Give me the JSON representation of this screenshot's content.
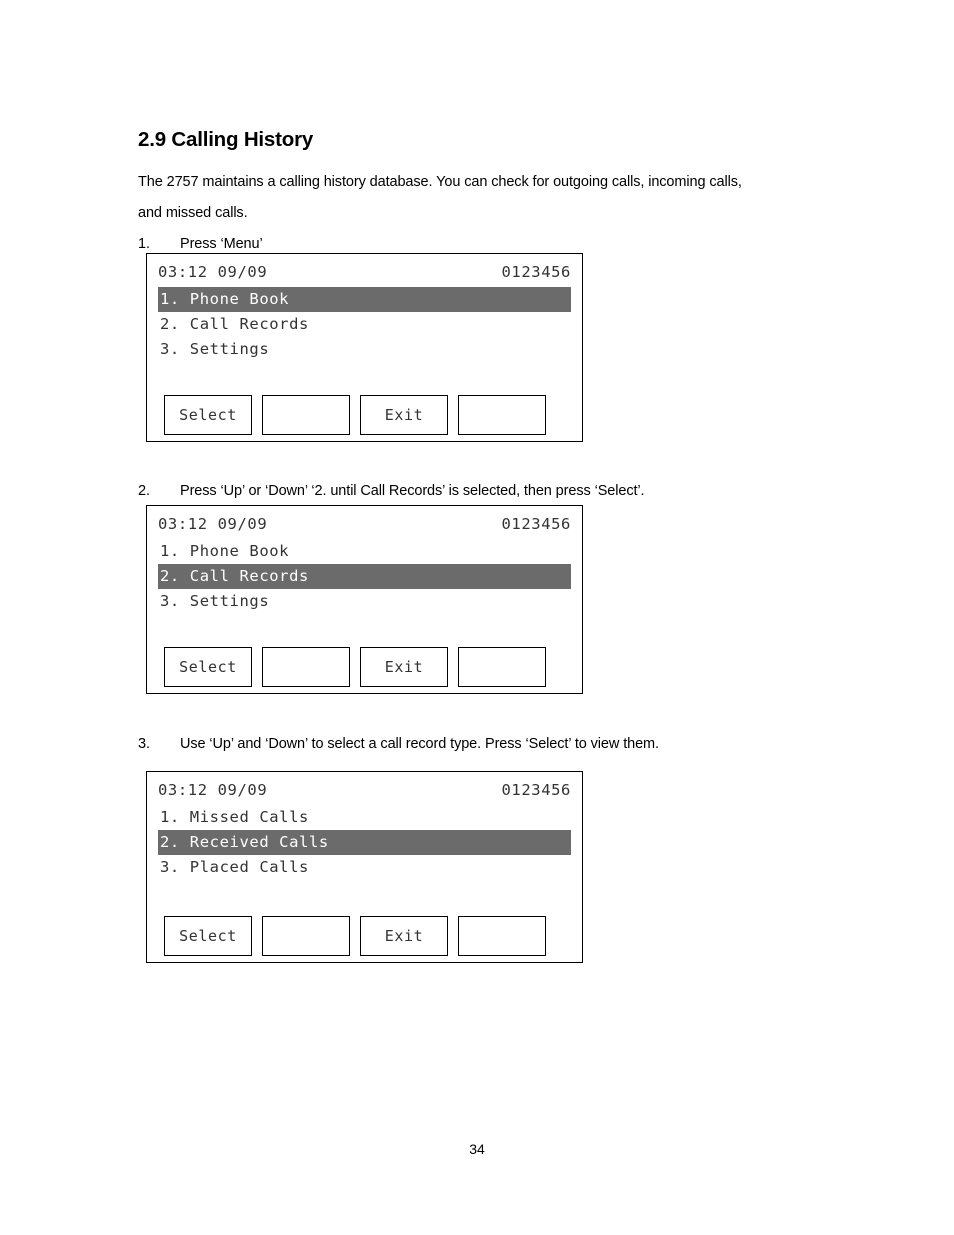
{
  "document": {
    "heading": "2.9 Calling History",
    "intro_line_1": "The 2757 maintains a calling history database.    You can check for outgoing calls, incoming calls,",
    "intro_line_2": "and missed calls.",
    "page_number": "34"
  },
  "steps": [
    {
      "number": "1.",
      "text": "Press ‘Menu’"
    },
    {
      "number": "2.",
      "text": "Press ‘Up’ or ‘Down’    ‘2. until Call Records’ is selected, then press ‘Select’."
    },
    {
      "number": "3.",
      "text": "Use ‘Up’ and ‘Down’ to select a call record type.    Press ‘Select’ to view them."
    }
  ],
  "screens": [
    {
      "id": "menu-screen",
      "header": {
        "time_date": "03:12 09/09",
        "line_id": "0123456"
      },
      "rows": [
        {
          "label": "1. Phone Book",
          "selected": true
        },
        {
          "label": "2. Call Records",
          "selected": false
        },
        {
          "label": "3. Settings",
          "selected": false
        }
      ],
      "softkeys": [
        {
          "label": "Select"
        },
        {
          "label": ""
        },
        {
          "label": "Exit"
        },
        {
          "label": ""
        }
      ]
    },
    {
      "id": "call-records-screen",
      "header": {
        "time_date": "03:12 09/09",
        "line_id": "0123456"
      },
      "rows": [
        {
          "label": "1. Phone Book",
          "selected": false
        },
        {
          "label": "2. Call Records",
          "selected": true
        },
        {
          "label": "3. Settings",
          "selected": false
        }
      ],
      "softkeys": [
        {
          "label": "Select"
        },
        {
          "label": ""
        },
        {
          "label": "Exit"
        },
        {
          "label": ""
        }
      ]
    },
    {
      "id": "record-type-screen",
      "header": {
        "time_date": "03:12 09/09",
        "line_id": "0123456"
      },
      "rows": [
        {
          "label": "1. Missed Calls",
          "selected": false
        },
        {
          "label": "2. Received Calls",
          "selected": true
        },
        {
          "label": "3. Placed Calls",
          "selected": false
        }
      ],
      "softkeys": [
        {
          "label": "Select"
        },
        {
          "label": ""
        },
        {
          "label": "Exit"
        },
        {
          "label": ""
        }
      ]
    }
  ],
  "colors": {
    "highlight_bg": "#6b6b6b",
    "highlight_fg": "#ffffff",
    "lcd_text": "#333333",
    "border": "#000000"
  }
}
